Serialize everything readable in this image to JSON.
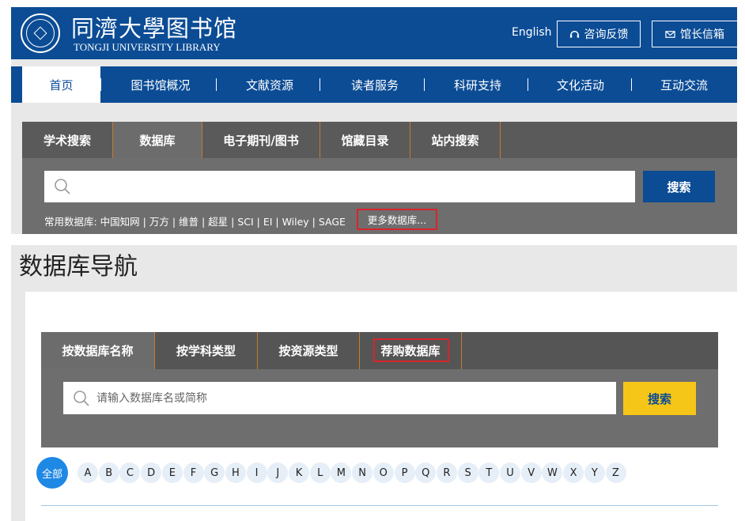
{
  "header": {
    "logo_cn": "同濟大學图书馆",
    "logo_en": "TONGJI UNIVERSITY LIBRARY",
    "lang_link": "English",
    "consult_button": "咨询反馈",
    "director_mail_button": "馆长信箱",
    "brand_color": "#0b4c95"
  },
  "nav": {
    "items": [
      "首页",
      "图书馆概况",
      "文献资源",
      "读者服务",
      "科研支持",
      "文化活动",
      "互动交流"
    ],
    "separator": "|",
    "active_index": 0
  },
  "search": {
    "tabs": [
      "学术搜索",
      "数据库",
      "电子期刊/图书",
      "馆藏目录",
      "站内搜索"
    ],
    "active_tab_index": 1,
    "input_value": "",
    "button": "搜索",
    "common_db_text": "常用数据库: 中国知网 | 万方 | 维普 | 超星 | SCI | EI | Wiley | SAGE",
    "more_db_link": "更多数据库..."
  },
  "db_nav": {
    "title": "数据库导航",
    "tabs": [
      "按数据库名称",
      "按学科类型",
      "按资源类型",
      "荐购数据库"
    ],
    "active_tab_index": 0,
    "input_placeholder": "请输入数据库名或简称",
    "button": "搜索",
    "button_color": "#f5c518",
    "alpha_all": "全部",
    "letters": [
      "A",
      "B",
      "C",
      "D",
      "E",
      "F",
      "G",
      "H",
      "I",
      "J",
      "K",
      "L",
      "M",
      "N",
      "O",
      "P",
      "Q",
      "R",
      "S",
      "T",
      "U",
      "V",
      "W",
      "X",
      "Y",
      "Z"
    ]
  },
  "highlight_color": "#d9242b"
}
